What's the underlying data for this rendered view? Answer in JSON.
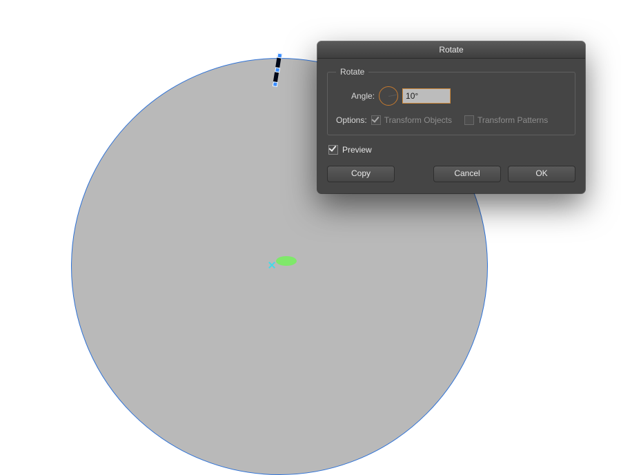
{
  "dialog": {
    "title": "Rotate",
    "group_label": "Rotate",
    "angle_label": "Angle:",
    "angle_value": "10°",
    "options_label": "Options:",
    "transform_objects_label": "Transform Objects",
    "transform_objects_checked": true,
    "transform_objects_enabled": false,
    "transform_patterns_label": "Transform Patterns",
    "transform_patterns_checked": false,
    "transform_patterns_enabled": false,
    "preview_label": "Preview",
    "preview_checked": true,
    "buttons": {
      "copy": "Copy",
      "cancel": "Cancel",
      "ok": "OK"
    }
  },
  "artwork": {
    "circle_fill": "#b9b9b9",
    "circle_stroke": "#2d71d6",
    "center_mark_color": "#7fe86a",
    "selection_handle_color": "#3a8dff",
    "tick_rotation_deg": 9
  }
}
